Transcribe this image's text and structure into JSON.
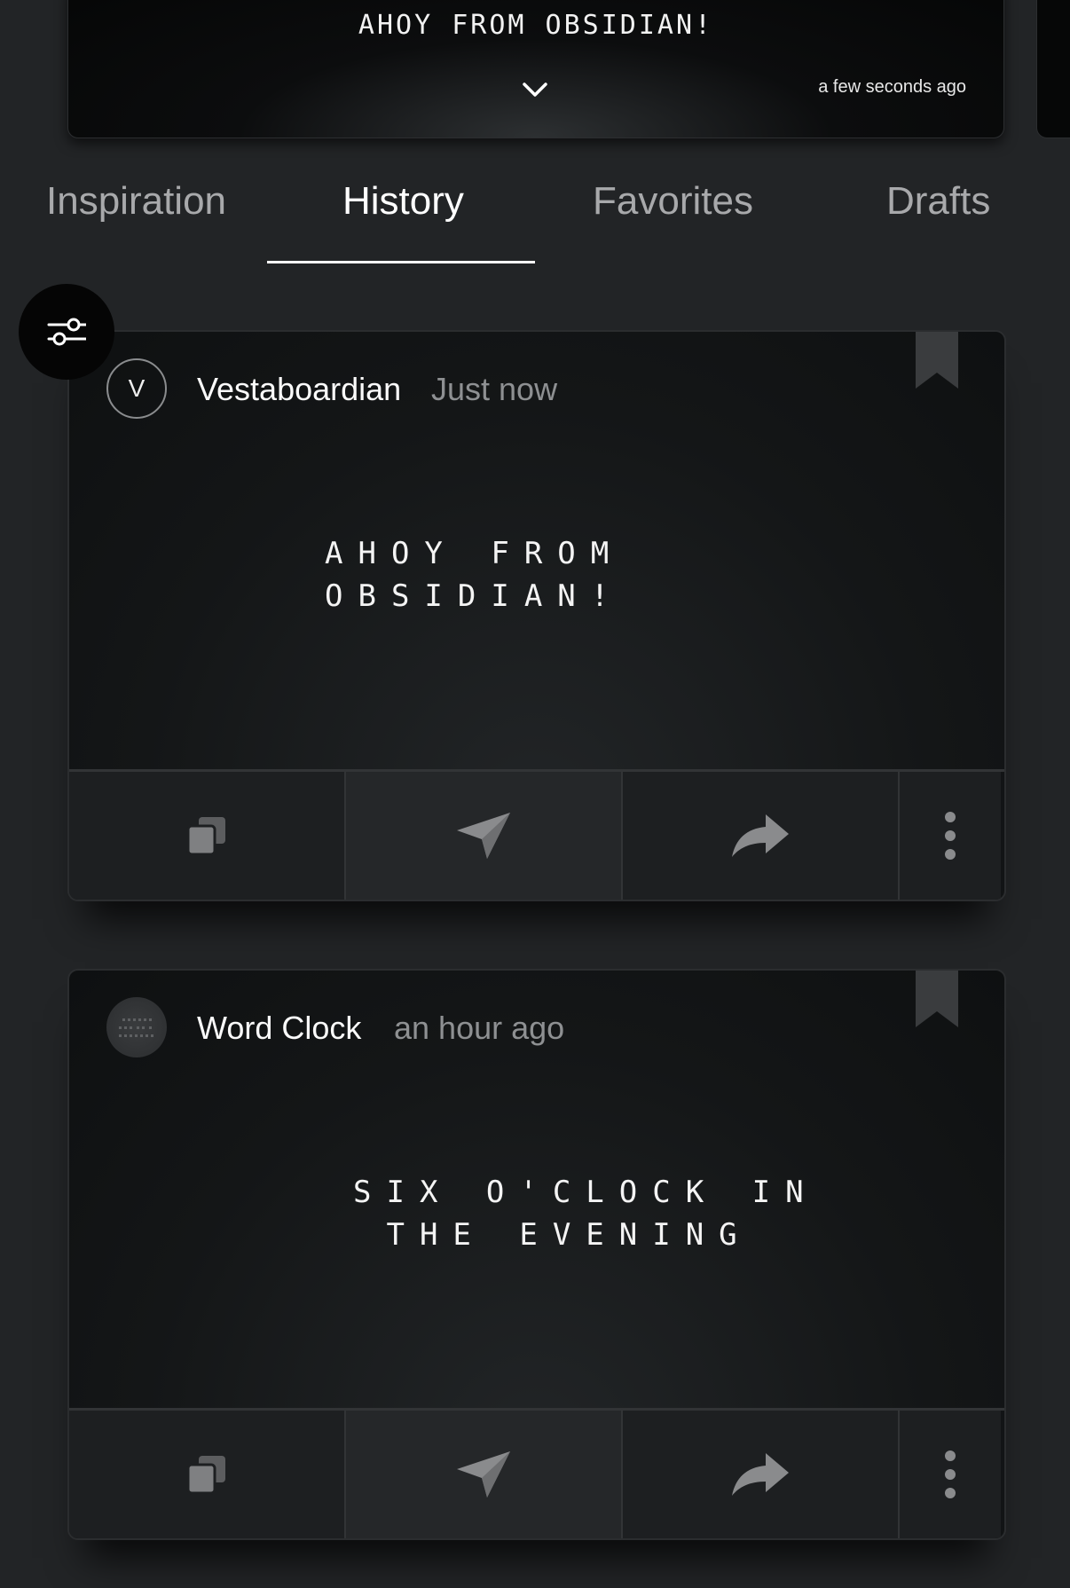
{
  "header_board": {
    "message": "AHOY FROM OBSIDIAN!",
    "timestamp": "a few seconds ago",
    "expand_icon": "chevron-down-icon"
  },
  "tabs": [
    {
      "label": "Inspiration",
      "active": false
    },
    {
      "label": "History",
      "active": true
    },
    {
      "label": "Favorites",
      "active": false
    },
    {
      "label": "Drafts",
      "active": false
    }
  ],
  "filter_button": {
    "icon": "sliders-icon"
  },
  "feed": [
    {
      "author": "Vestaboardian",
      "avatar_initial": "V",
      "time": "Just now",
      "message_lines": "AHOY FROM\nOBSIDIAN!",
      "actions": [
        "copy-icon",
        "send-icon",
        "share-icon",
        "more-vertical-icon"
      ]
    },
    {
      "author": "Word Clock",
      "avatar_initial": "",
      "time": "an hour ago",
      "message_lines": "SIX O'CLOCK IN\n THE EVENING",
      "actions": [
        "copy-icon",
        "send-icon",
        "share-icon",
        "more-vertical-icon"
      ]
    }
  ],
  "colors": {
    "background": "#222426",
    "card": "#141617",
    "accent": "#ffffff",
    "muted_text": "#8e9092",
    "icon": "#8a8a8a"
  }
}
